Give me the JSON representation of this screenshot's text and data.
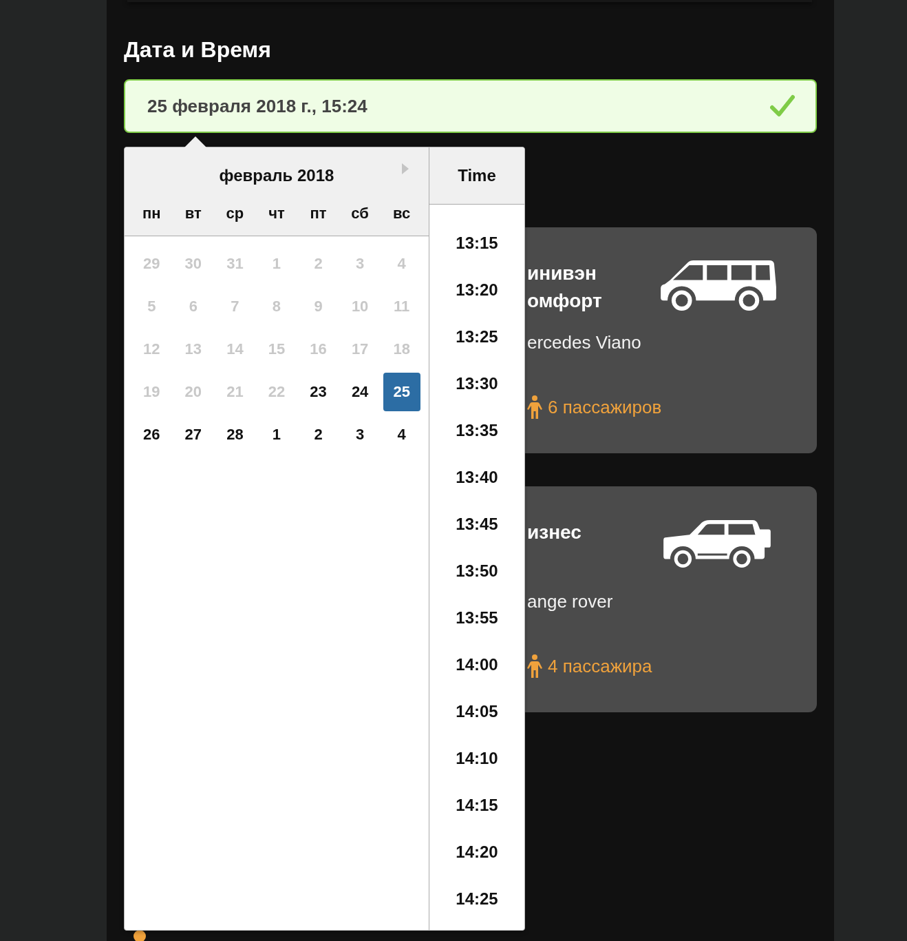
{
  "section": {
    "title": "Дата и Время"
  },
  "datetime_field": {
    "value": "25 февраля 2018 г., 15:24",
    "valid": true
  },
  "datepicker": {
    "month_title": "февраль 2018",
    "weekdays": [
      "пн",
      "вт",
      "ср",
      "чт",
      "пт",
      "сб",
      "вс"
    ],
    "days": [
      {
        "label": "29",
        "disabled": true,
        "selected": false
      },
      {
        "label": "30",
        "disabled": true,
        "selected": false
      },
      {
        "label": "31",
        "disabled": true,
        "selected": false
      },
      {
        "label": "1",
        "disabled": true,
        "selected": false
      },
      {
        "label": "2",
        "disabled": true,
        "selected": false
      },
      {
        "label": "3",
        "disabled": true,
        "selected": false
      },
      {
        "label": "4",
        "disabled": true,
        "selected": false
      },
      {
        "label": "5",
        "disabled": true,
        "selected": false
      },
      {
        "label": "6",
        "disabled": true,
        "selected": false
      },
      {
        "label": "7",
        "disabled": true,
        "selected": false
      },
      {
        "label": "8",
        "disabled": true,
        "selected": false
      },
      {
        "label": "9",
        "disabled": true,
        "selected": false
      },
      {
        "label": "10",
        "disabled": true,
        "selected": false
      },
      {
        "label": "11",
        "disabled": true,
        "selected": false
      },
      {
        "label": "12",
        "disabled": true,
        "selected": false
      },
      {
        "label": "13",
        "disabled": true,
        "selected": false
      },
      {
        "label": "14",
        "disabled": true,
        "selected": false
      },
      {
        "label": "15",
        "disabled": true,
        "selected": false
      },
      {
        "label": "16",
        "disabled": true,
        "selected": false
      },
      {
        "label": "17",
        "disabled": true,
        "selected": false
      },
      {
        "label": "18",
        "disabled": true,
        "selected": false
      },
      {
        "label": "19",
        "disabled": true,
        "selected": false
      },
      {
        "label": "20",
        "disabled": true,
        "selected": false
      },
      {
        "label": "21",
        "disabled": true,
        "selected": false
      },
      {
        "label": "22",
        "disabled": true,
        "selected": false
      },
      {
        "label": "23",
        "disabled": false,
        "selected": false
      },
      {
        "label": "24",
        "disabled": false,
        "selected": false
      },
      {
        "label": "25",
        "disabled": false,
        "selected": true
      },
      {
        "label": "26",
        "disabled": false,
        "selected": false
      },
      {
        "label": "27",
        "disabled": false,
        "selected": false
      },
      {
        "label": "28",
        "disabled": false,
        "selected": false
      },
      {
        "label": "1",
        "disabled": false,
        "selected": false
      },
      {
        "label": "2",
        "disabled": false,
        "selected": false
      },
      {
        "label": "3",
        "disabled": false,
        "selected": false
      },
      {
        "label": "4",
        "disabled": false,
        "selected": false
      }
    ],
    "time_header": "Time",
    "times": [
      "13:15",
      "13:20",
      "13:25",
      "13:30",
      "13:35",
      "13:40",
      "13:45",
      "13:50",
      "13:55",
      "14:00",
      "14:05",
      "14:10",
      "14:15",
      "14:20",
      "14:25"
    ]
  },
  "vehicles": [
    {
      "kind": "minivan",
      "title": "инивэн омфорт",
      "model": "ercedes Viano",
      "passengers": "6 пассажиров"
    },
    {
      "kind": "suv",
      "title": "изнес",
      "model": "ange rover",
      "passengers": "4 пассажира"
    }
  ]
}
